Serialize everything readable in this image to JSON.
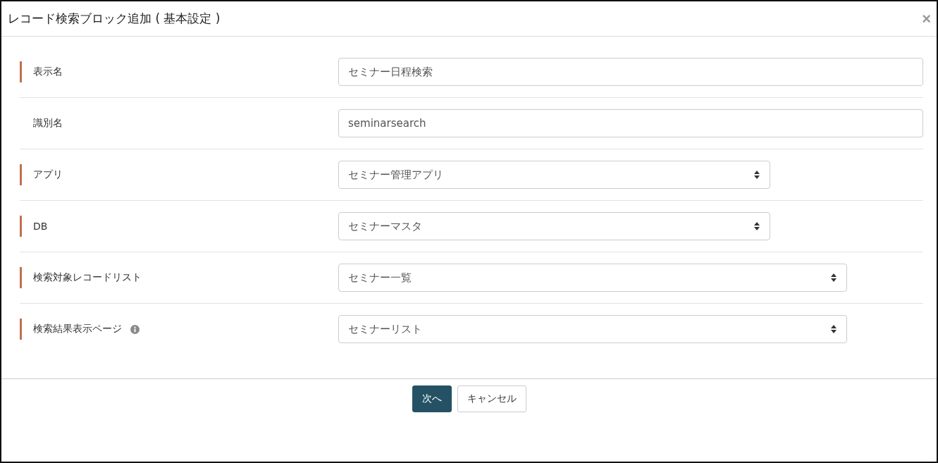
{
  "dialog": {
    "title": "レコード検索ブロック追加 ( 基本設定 )",
    "close": "×"
  },
  "fields": [
    {
      "label": "表示名",
      "required": true,
      "info": false,
      "kind": "text",
      "value": "セミナー日程検索"
    },
    {
      "label": "識別名",
      "required": false,
      "info": false,
      "kind": "text",
      "value": "seminarsearch"
    },
    {
      "label": "アプリ",
      "required": true,
      "info": false,
      "kind": "select",
      "value": "セミナー管理アプリ"
    },
    {
      "label": "DB",
      "required": true,
      "info": false,
      "kind": "select",
      "value": "セミナーマスタ"
    },
    {
      "label": "検索対象レコードリスト",
      "required": true,
      "info": false,
      "kind": "select",
      "value": "セミナー一覧"
    },
    {
      "label": "検索結果表示ページ",
      "required": true,
      "info": true,
      "kind": "select",
      "value": "セミナーリスト"
    }
  ],
  "buttons": [
    {
      "label": "次へ",
      "kind": "primary"
    },
    {
      "label": "キャンセル",
      "kind": "secondary"
    }
  ]
}
